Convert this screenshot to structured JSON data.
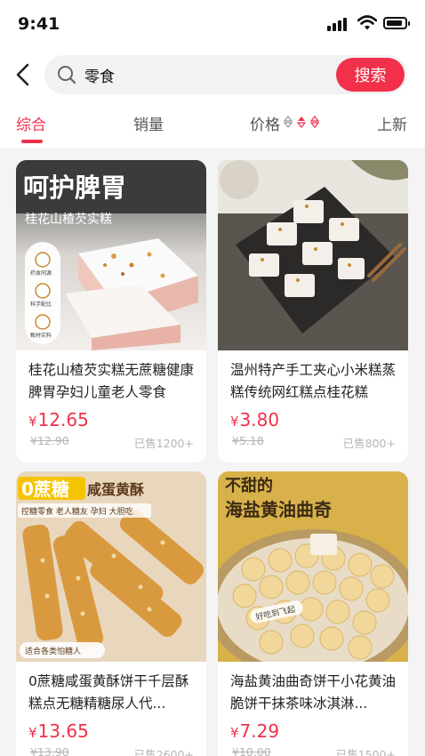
{
  "status": {
    "time": "9:41"
  },
  "search": {
    "query": "零食",
    "button_label": "搜索"
  },
  "tabs": [
    {
      "label": "综合",
      "active": true
    },
    {
      "label": "销量",
      "active": false
    },
    {
      "label": "价格",
      "active": false
    },
    {
      "label": "上新",
      "active": false
    }
  ],
  "icons": {
    "back": "chevron-left-icon",
    "search": "search-icon",
    "signal": "cellular-signal-icon",
    "wifi": "wifi-icon",
    "battery": "battery-icon",
    "sort": "sort-arrows-icon"
  },
  "colors": {
    "accent": "#f2304a",
    "muted": "#b5b5b5",
    "text": "#222222"
  },
  "products": [
    {
      "title": "桂花山楂芡实糕无蔗糖健康脾胃孕妇儿童老人零食",
      "currency": "¥",
      "price": "12.65",
      "original_price": "¥12.90",
      "sold": "已售1200+",
      "image_text": {
        "headline": "呵护脾胃",
        "subline": "桂花山楂芡实糕",
        "badges": [
          "药食同源",
          "科学配比",
          "甄材实料"
        ]
      }
    },
    {
      "title": "温州特产手工夹心小米糕蒸糕传统网红糕点桂花糕",
      "currency": "¥",
      "price": "3.80",
      "original_price": "¥5.18",
      "sold": "已售800+"
    },
    {
      "title": "0蔗糖咸蛋黄酥饼干千层酥糕点无糖精糖尿人代...",
      "currency": "¥",
      "price": "13.65",
      "original_price": "¥13.90",
      "sold": "已售2600+",
      "image_text": {
        "headline_a": "0蔗糖",
        "headline_b": "咸蛋黄酥",
        "subline": "控糖零食 老人糖友 孕妇 大胆吃",
        "corner": "适合各类怕糖人"
      }
    },
    {
      "title": "海盐黄油曲奇饼干小花黄油脆饼干抹茶味冰淇淋...",
      "currency": "¥",
      "price": "7.29",
      "original_price": "¥10.00",
      "sold": "已售1500+",
      "image_text": {
        "headline_a": "不甜的",
        "headline_b": "海盐黄油曲奇",
        "tag": "好吃到飞起"
      }
    }
  ]
}
